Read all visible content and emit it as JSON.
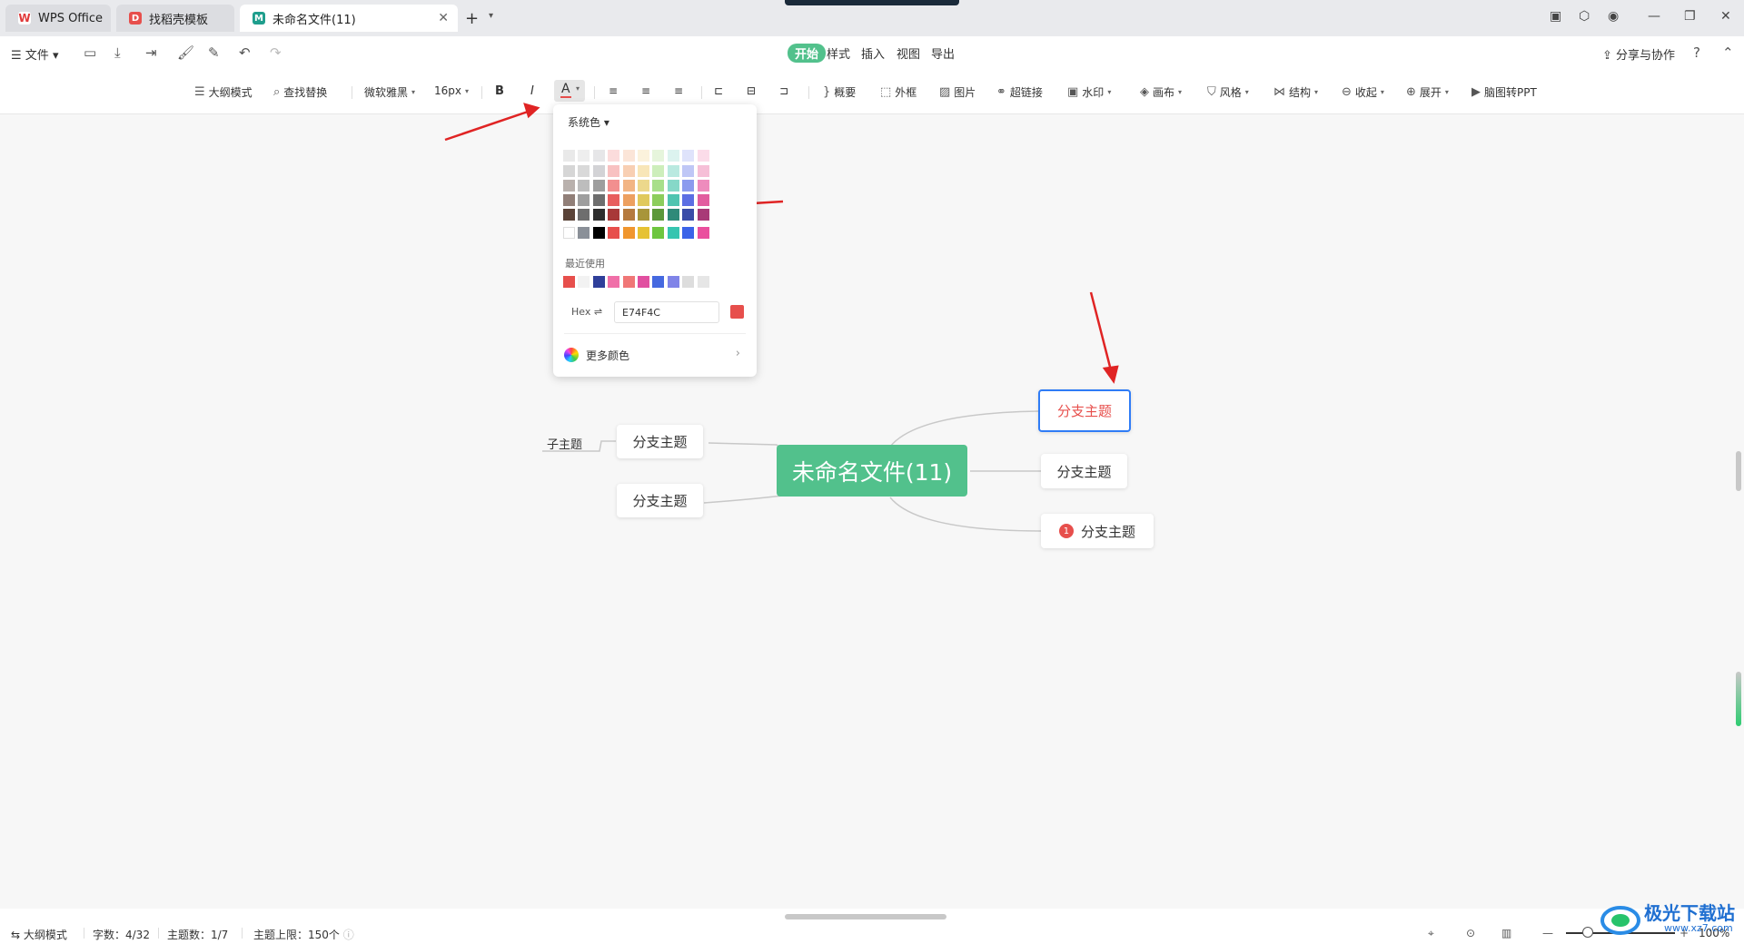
{
  "tabs": [
    {
      "label": "WPS Office",
      "icon": "wps-logo-icon"
    },
    {
      "label": "找稻壳模板",
      "icon": "docer-icon"
    },
    {
      "label": "未命名文件(11)",
      "icon": "mindmap-file-icon",
      "active": true
    }
  ],
  "menu": {
    "file_label": "文件",
    "tabs": [
      "开始",
      "样式",
      "插入",
      "视图",
      "导出"
    ],
    "active_tab": "开始",
    "share_label": "分享与协作"
  },
  "toolbar": {
    "outline_mode": "大纲模式",
    "find_replace": "查找替换",
    "font_family": "微软雅黑",
    "font_size": "16px",
    "bold": "B",
    "italic": "I",
    "font_color": "A",
    "summary": "概要",
    "frame": "外框",
    "image": "图片",
    "hyperlink": "超链接",
    "watermark": "水印",
    "canvas": "画布",
    "style": "风格",
    "structure": "结构",
    "collapse": "收起",
    "expand": "展开",
    "to_ppt": "脑图转PPT"
  },
  "color_popup": {
    "palette_label": "系统色",
    "recent_label": "最近使用",
    "hex_label": "Hex",
    "hex_value": "E74F4C",
    "more_colors": "更多颜色",
    "grid": [
      [
        "#e9e9e9",
        "#eeeeee",
        "#e6e6e8",
        "#fbdcdc",
        "#fbe5d8",
        "#fbf2dc",
        "#e6f5dc",
        "#dcf3ef",
        "#dfe3fb",
        "#fbdce9"
      ],
      [
        "#d6d6d6",
        "#d9d9d9",
        "#d3d3d6",
        "#f8c1c1",
        "#f8cfb3",
        "#f8e6b8",
        "#cdeebb",
        "#b9e9e0",
        "#bfc7f6",
        "#f6bfd7"
      ],
      [
        "#b9b1ad",
        "#bdbdbd",
        "#9e9e9e",
        "#f28f8f",
        "#f2b584",
        "#ecd88c",
        "#a8df8a",
        "#86d8c8",
        "#8c9bee",
        "#ee8cbd"
      ],
      [
        "#917f78",
        "#9e9e9e",
        "#6e6e6e",
        "#e85e5e",
        "#eda060",
        "#e0c95c",
        "#8ccd5c",
        "#4fc4b0",
        "#5c6ee3",
        "#e25c9f"
      ],
      [
        "#5a4338",
        "#6e6e6e",
        "#2e2e2e",
        "#a83838",
        "#b57a3e",
        "#a8953a",
        "#5c983a",
        "#2f8a79",
        "#3a4ca8",
        "#a83a77"
      ],
      [
        "#ffffff",
        "#8a9098",
        "#000000",
        "#e74f4c",
        "#f0962e",
        "#e6c233",
        "#6ec63f",
        "#36c5b0",
        "#3b63e8",
        "#ea4f9e"
      ]
    ],
    "recent": [
      "#e74f4c",
      "#f2f2f2",
      "#2f3f9a",
      "#f06fa8",
      "#f07777",
      "#e14fa0",
      "#4569e0",
      "#8084e8",
      "#dddddd",
      "#e6e6e6"
    ]
  },
  "mindmap": {
    "central": "未命名文件(11)",
    "left_branch_1": "分支主题",
    "left_branch_2": "分支主题",
    "left_sub": "子主题",
    "right_branch_1": "分支主题",
    "right_branch_2": "分支主题",
    "right_branch_3": "分支主题",
    "right_branch_3_badge": "1",
    "selected_text_color": "#e74f4c",
    "central_color": "#52c18c"
  },
  "status": {
    "outline_mode": "大纲模式",
    "word_count": "字数：4/32",
    "topic_count": "主题数：1/7",
    "topic_limit": "主题上限：150个",
    "zoom": "100%"
  },
  "watermark": {
    "text": "极光下载站",
    "url": "www.xz7.com"
  },
  "colors": {
    "accent_green": "#52c18c",
    "selection_blue": "#2f7cf6",
    "arrow_red": "#e02424"
  }
}
